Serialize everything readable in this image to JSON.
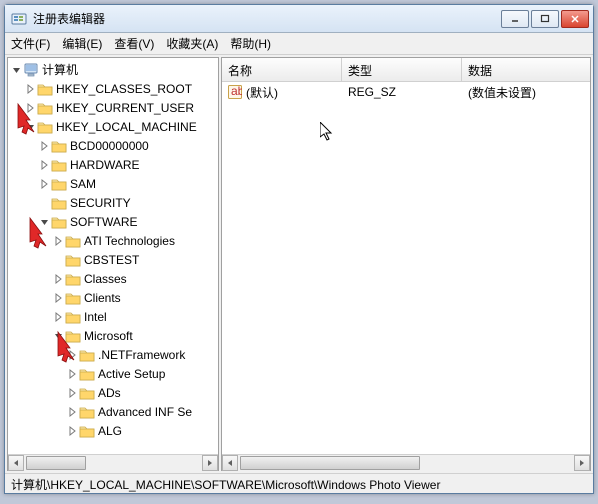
{
  "window": {
    "title": "注册表编辑器"
  },
  "menu": {
    "file": "文件(F)",
    "edit": "编辑(E)",
    "view": "查看(V)",
    "favorites": "收藏夹(A)",
    "help": "帮助(H)"
  },
  "tree": {
    "root": "计算机",
    "n0": "HKEY_CLASSES_ROOT",
    "n1": "HKEY_CURRENT_USER",
    "n2": "HKEY_LOCAL_MACHINE",
    "n2_0": "BCD00000000",
    "n2_1": "HARDWARE",
    "n2_2": "SAM",
    "n2_3": "SECURITY",
    "n2_4": "SOFTWARE",
    "n2_4_0": "ATI Technologies",
    "n2_4_1": "CBSTEST",
    "n2_4_2": "Classes",
    "n2_4_3": "Clients",
    "n2_4_4": "Intel",
    "n2_4_5": "Microsoft",
    "n2_4_5_0": ".NETFramework",
    "n2_4_5_1": "Active Setup",
    "n2_4_5_2": "ADs",
    "n2_4_5_3": "Advanced INF Se",
    "n2_4_5_4": "ALG"
  },
  "columns": {
    "name": "名称",
    "type": "类型",
    "data": "数据"
  },
  "value_row": {
    "name": "(默认)",
    "type": "REG_SZ",
    "data": "(数值未设置)"
  },
  "statusbar": "计算机\\HKEY_LOCAL_MACHINE\\SOFTWARE\\Microsoft\\Windows Photo Viewer"
}
